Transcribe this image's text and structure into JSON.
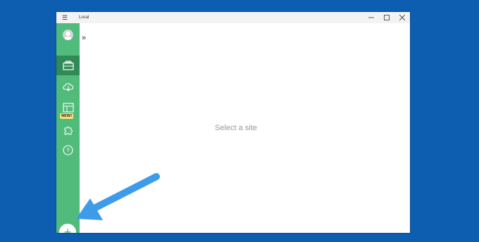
{
  "window": {
    "title": "Local",
    "menu_icon": "hamburger-icon",
    "controls": [
      "minimize-icon",
      "maximize-icon",
      "close-icon"
    ]
  },
  "sidebar": {
    "items": [
      {
        "name": "avatar",
        "icon": "user-avatar"
      },
      {
        "name": "sites",
        "icon": "sites-stack-icon",
        "active": true
      },
      {
        "name": "connect",
        "icon": "cloud-icon"
      },
      {
        "name": "blueprints",
        "icon": "blueprint-icon",
        "badge": "NEW!"
      },
      {
        "name": "addons",
        "icon": "puzzle-icon"
      },
      {
        "name": "help",
        "icon": "help-icon"
      }
    ],
    "add_label": "+",
    "accent_color": "#51bb7b",
    "active_color": "#2f8a56"
  },
  "main": {
    "expand_glyph": "»",
    "empty_message": "Select a site"
  },
  "annotation": {
    "arrow_color": "#3d9be9"
  },
  "desktop_color": "#0d5eb0"
}
